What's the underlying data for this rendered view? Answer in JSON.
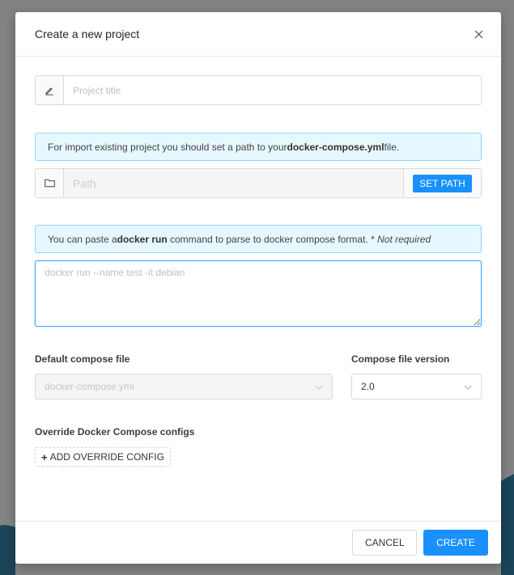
{
  "modal": {
    "title": "Create a new project"
  },
  "project_title": {
    "placeholder": "Project title"
  },
  "import_alert": {
    "text_before": "For import existing project you should set a path to your ",
    "bold": "docker-compose.yml",
    "text_after": "file."
  },
  "path": {
    "placeholder": "Path",
    "button_label": "SET PATH"
  },
  "docker_run_alert": {
    "text_before": "You can paste a ",
    "bold": "docker run",
    "text_after": " command to parse to docker compose format. * ",
    "italic": "Not required"
  },
  "docker_run_input": {
    "placeholder": "docker run --name test -it debian"
  },
  "default_compose": {
    "label": "Default compose file",
    "value": "docker-compose.yml"
  },
  "compose_version": {
    "label": "Compose file version",
    "value": "2.0"
  },
  "override": {
    "label": "Override Docker Compose configs",
    "button_label": "ADD OVERRIDE CONFIG"
  },
  "footer": {
    "cancel_label": "CANCEL",
    "create_label": "CREATE"
  },
  "colors": {
    "primary": "#1890ff",
    "alert_bg": "#e6f7ff",
    "alert_border": "#91d5ff",
    "backdrop": "#808284",
    "backdrop_wave": "#1b4458"
  }
}
